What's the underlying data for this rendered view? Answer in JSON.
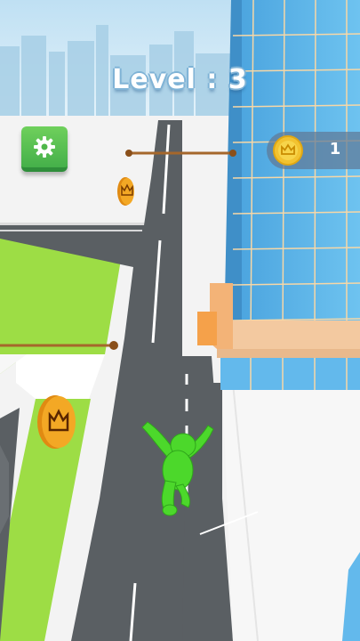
{
  "hud": {
    "level_label": "Level : 3",
    "coin_count": "1"
  },
  "icons": {
    "settings": "gear-icon",
    "coin": "crown-coin-icon",
    "collectible": "crown-coin-icon"
  },
  "colors": {
    "sky": "#cfe7f5",
    "grass": "#9ddd45",
    "road": "#5a5f63",
    "building_glass": "#63b9ec",
    "player": "#4cd82b",
    "coin": "#f0a020",
    "settings_button": "#4fb84a"
  }
}
